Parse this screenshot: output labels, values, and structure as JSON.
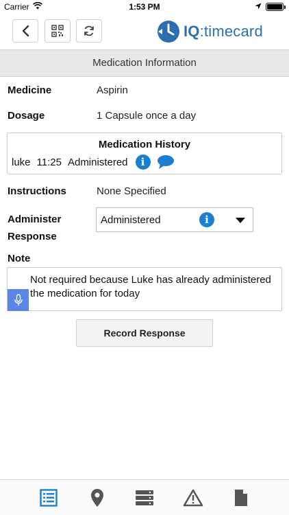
{
  "status_bar": {
    "carrier": "Carrier",
    "time": "1:53 PM"
  },
  "header": {
    "logo_main": "IQ",
    "logo_sub": ":timecard",
    "brand_color": "#2c6fb0"
  },
  "title": "Medication Information",
  "fields": {
    "medicine_label": "Medicine",
    "medicine_value": "Aspirin",
    "dosage_label": "Dosage",
    "dosage_value": "1 Capsule once a day",
    "instructions_label": "Instructions",
    "instructions_value": "None Specified",
    "administer_label_line1": "Administer",
    "administer_label_line2": "Response",
    "note_label": "Note"
  },
  "history": {
    "title": "Medication History",
    "entries": [
      {
        "user": "luke",
        "time": "11:25",
        "status": "Administered"
      }
    ]
  },
  "administer_select": {
    "value": "Administered"
  },
  "note": {
    "text": "Not required because Luke has already administered the medication for today"
  },
  "record_button": "Record Response",
  "colors": {
    "accent": "#1a7fd0",
    "mic": "#5b86e5",
    "nav_active": "#1a7fd0",
    "nav_inactive": "#555555"
  },
  "bottom_nav": [
    "list-icon",
    "location-pin-icon",
    "server-icon",
    "warning-icon",
    "document-icon"
  ]
}
